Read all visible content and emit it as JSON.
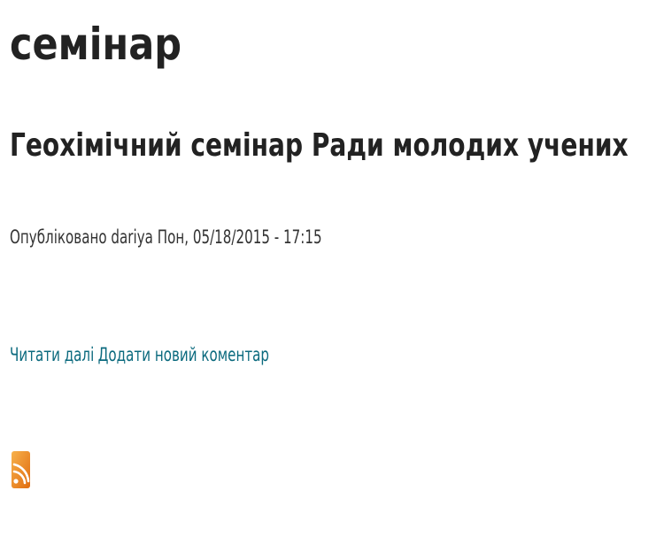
{
  "page": {
    "title": "семінар"
  },
  "node": {
    "title": "Геохімічний семінар Ради молодих учених",
    "submitted": "Опубліковано dariya Пон, 05/18/2015 - 17:15",
    "links": {
      "read_more": "Читати далі",
      "add_comment": "Додати новий коментар"
    }
  },
  "feed": {
    "icon": "rss-feed-icon",
    "color": "#f28c1d"
  }
}
